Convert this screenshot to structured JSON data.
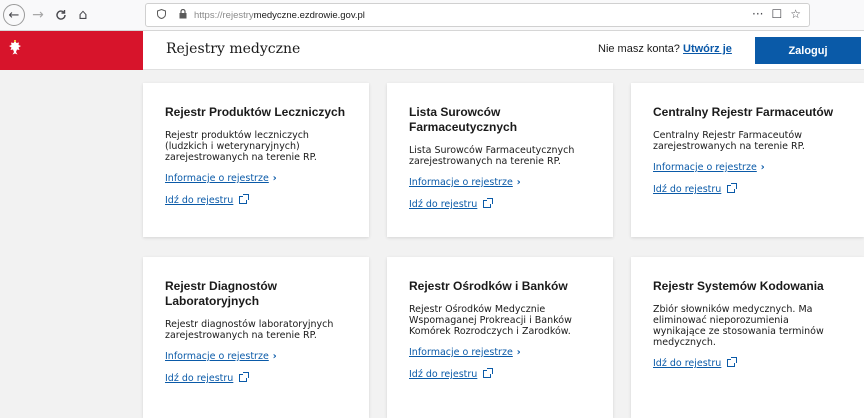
{
  "browser": {
    "url_prefix": "https://rejestry",
    "url_domain": "medyczne.ezdrowie.gov.pl",
    "back_icon": "←",
    "forward_icon": "→",
    "reload_icon": "C",
    "home_icon": "⌂",
    "url_actions": [
      "···",
      "☐",
      "☆"
    ]
  },
  "header": {
    "title": "Rejestry medyczne",
    "no_account": "Nie masz konta?",
    "create_account": "Utwórz je",
    "login": "Zaloguj",
    "brand_color": "#d7142b",
    "accent_color": "#0a5aa8"
  },
  "cards": [
    {
      "title": "Rejestr Produktów Leczniczych",
      "description": "Rejestr produktów leczniczych (ludzkich i weterynaryjnych) zarejestrowanych na terenie RP.",
      "info_link": "Informacje o rejestrze",
      "go_link": "Idź do rejestru"
    },
    {
      "title": "Lista Surowców Farmaceutycznych",
      "description": "Lista Surowców Farmaceutycznych zarejestrowanych na terenie RP.",
      "info_link": "Informacje o rejestrze",
      "go_link": "Idź do rejestru"
    },
    {
      "title": "Centralny Rejestr Farmaceutów",
      "description": "Centralny Rejestr Farmaceutów zarejestrowanych na terenie RP.",
      "info_link": "Informacje o rejestrze",
      "go_link": "Idź do rejestru"
    },
    {
      "title": "Rejestr Diagnostów Laboratoryjnych",
      "description": "Rejestr diagnostów laboratoryjnych zarejestrowanych na terenie RP.",
      "info_link": "Informacje o rejestrze",
      "go_link": "Idź do rejestru"
    },
    {
      "title": "Rejestr Ośrodków i Banków",
      "description": "Rejestr Ośrodków Medycznie Wspomaganej Prokreacji i Banków Komórek Rozrodczych i Zarodków.",
      "info_link": "Informacje o rejestrze",
      "go_link": "Idź do rejestru"
    },
    {
      "title": "Rejestr Systemów Kodowania",
      "description": "Zbiór słowników medycznych. Ma eliminować nieporozumienia wynikające ze stosowania terminów medycznych.",
      "go_link": "Idź do rejestru"
    }
  ]
}
